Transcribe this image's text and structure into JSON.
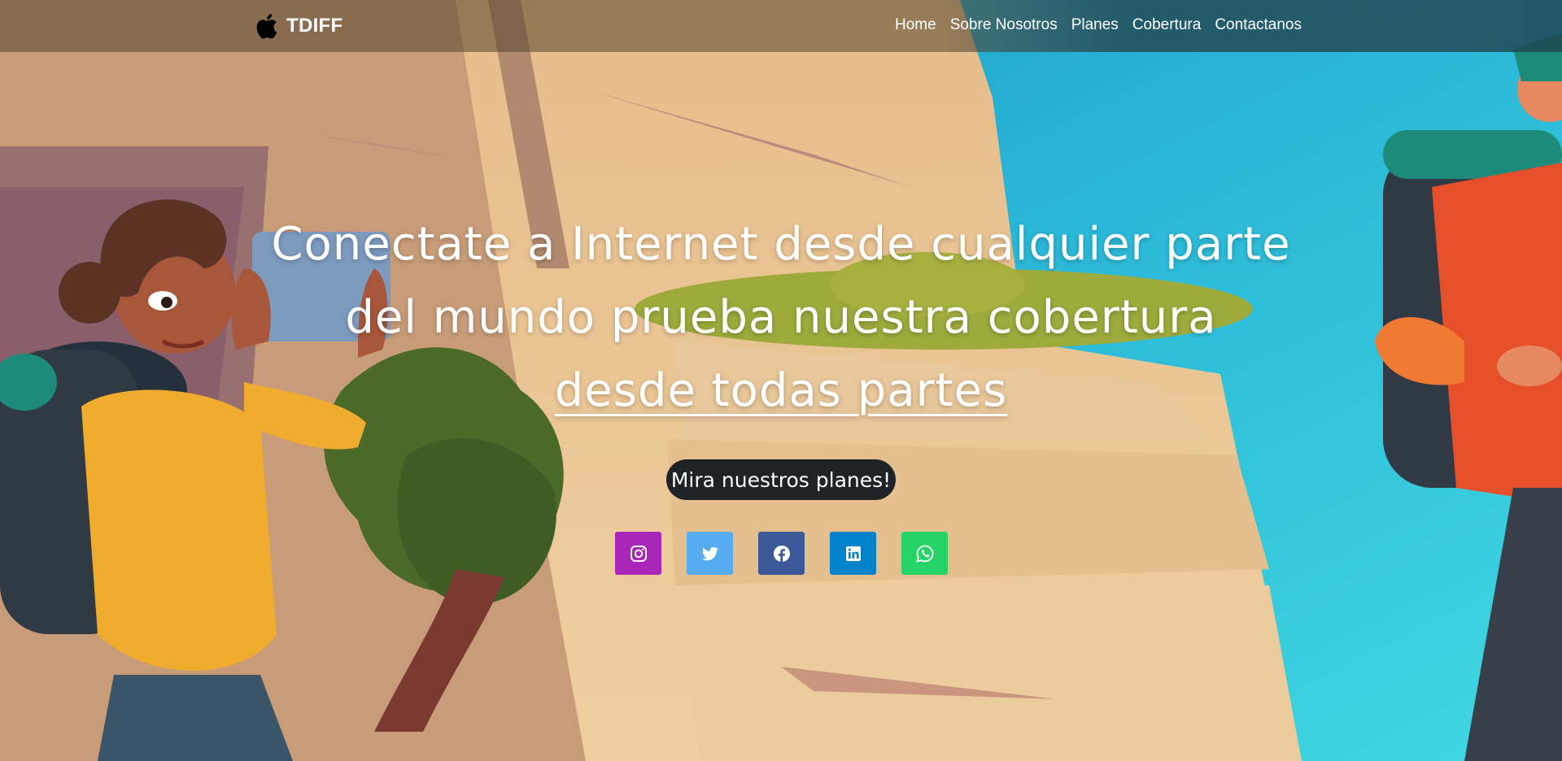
{
  "brand": {
    "name": "TDIFF",
    "icon": "apple-icon"
  },
  "nav": {
    "items": [
      {
        "label": "Home"
      },
      {
        "label": "Sobre Nosotros"
      },
      {
        "label": "Planes"
      },
      {
        "label": "Cobertura"
      },
      {
        "label": "Contactanos"
      }
    ]
  },
  "hero": {
    "title_line1": "Conectate a Internet desde cualquier parte",
    "title_line2": "del mundo prueba nuestra cobertura",
    "title_line3": "desde todas partes",
    "cta_label": "Mira nuestros planes!"
  },
  "socials": [
    {
      "icon": "instagram-icon",
      "color": "#a726b8"
    },
    {
      "icon": "twitter-icon",
      "color": "#55acee"
    },
    {
      "icon": "facebook-icon",
      "color": "#3b5998"
    },
    {
      "icon": "linkedin-icon",
      "color": "#0082ca"
    },
    {
      "icon": "whatsapp-icon",
      "color": "#25d366"
    }
  ],
  "colors": {
    "cta_bg": "#1f2226",
    "sky": "#2bb8d8",
    "cliff": "#e8c18e"
  }
}
